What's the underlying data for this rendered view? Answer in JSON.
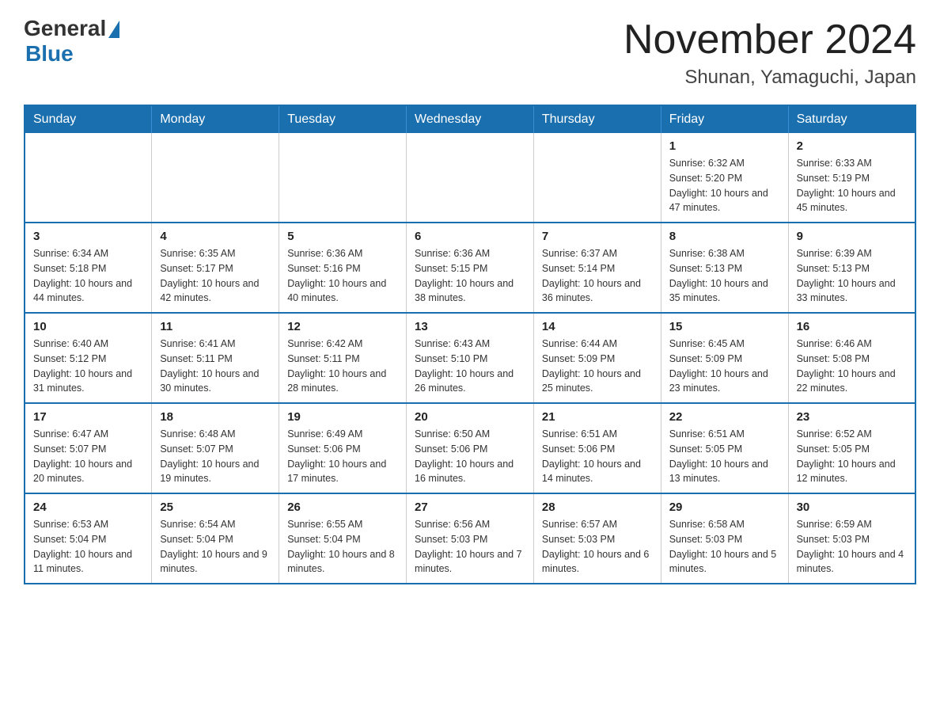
{
  "logo": {
    "general": "General",
    "blue": "Blue"
  },
  "title": {
    "month_year": "November 2024",
    "location": "Shunan, Yamaguchi, Japan"
  },
  "headers": [
    "Sunday",
    "Monday",
    "Tuesday",
    "Wednesday",
    "Thursday",
    "Friday",
    "Saturday"
  ],
  "weeks": [
    [
      {
        "day": "",
        "info": ""
      },
      {
        "day": "",
        "info": ""
      },
      {
        "day": "",
        "info": ""
      },
      {
        "day": "",
        "info": ""
      },
      {
        "day": "",
        "info": ""
      },
      {
        "day": "1",
        "info": "Sunrise: 6:32 AM\nSunset: 5:20 PM\nDaylight: 10 hours and 47 minutes."
      },
      {
        "day": "2",
        "info": "Sunrise: 6:33 AM\nSunset: 5:19 PM\nDaylight: 10 hours and 45 minutes."
      }
    ],
    [
      {
        "day": "3",
        "info": "Sunrise: 6:34 AM\nSunset: 5:18 PM\nDaylight: 10 hours and 44 minutes."
      },
      {
        "day": "4",
        "info": "Sunrise: 6:35 AM\nSunset: 5:17 PM\nDaylight: 10 hours and 42 minutes."
      },
      {
        "day": "5",
        "info": "Sunrise: 6:36 AM\nSunset: 5:16 PM\nDaylight: 10 hours and 40 minutes."
      },
      {
        "day": "6",
        "info": "Sunrise: 6:36 AM\nSunset: 5:15 PM\nDaylight: 10 hours and 38 minutes."
      },
      {
        "day": "7",
        "info": "Sunrise: 6:37 AM\nSunset: 5:14 PM\nDaylight: 10 hours and 36 minutes."
      },
      {
        "day": "8",
        "info": "Sunrise: 6:38 AM\nSunset: 5:13 PM\nDaylight: 10 hours and 35 minutes."
      },
      {
        "day": "9",
        "info": "Sunrise: 6:39 AM\nSunset: 5:13 PM\nDaylight: 10 hours and 33 minutes."
      }
    ],
    [
      {
        "day": "10",
        "info": "Sunrise: 6:40 AM\nSunset: 5:12 PM\nDaylight: 10 hours and 31 minutes."
      },
      {
        "day": "11",
        "info": "Sunrise: 6:41 AM\nSunset: 5:11 PM\nDaylight: 10 hours and 30 minutes."
      },
      {
        "day": "12",
        "info": "Sunrise: 6:42 AM\nSunset: 5:11 PM\nDaylight: 10 hours and 28 minutes."
      },
      {
        "day": "13",
        "info": "Sunrise: 6:43 AM\nSunset: 5:10 PM\nDaylight: 10 hours and 26 minutes."
      },
      {
        "day": "14",
        "info": "Sunrise: 6:44 AM\nSunset: 5:09 PM\nDaylight: 10 hours and 25 minutes."
      },
      {
        "day": "15",
        "info": "Sunrise: 6:45 AM\nSunset: 5:09 PM\nDaylight: 10 hours and 23 minutes."
      },
      {
        "day": "16",
        "info": "Sunrise: 6:46 AM\nSunset: 5:08 PM\nDaylight: 10 hours and 22 minutes."
      }
    ],
    [
      {
        "day": "17",
        "info": "Sunrise: 6:47 AM\nSunset: 5:07 PM\nDaylight: 10 hours and 20 minutes."
      },
      {
        "day": "18",
        "info": "Sunrise: 6:48 AM\nSunset: 5:07 PM\nDaylight: 10 hours and 19 minutes."
      },
      {
        "day": "19",
        "info": "Sunrise: 6:49 AM\nSunset: 5:06 PM\nDaylight: 10 hours and 17 minutes."
      },
      {
        "day": "20",
        "info": "Sunrise: 6:50 AM\nSunset: 5:06 PM\nDaylight: 10 hours and 16 minutes."
      },
      {
        "day": "21",
        "info": "Sunrise: 6:51 AM\nSunset: 5:06 PM\nDaylight: 10 hours and 14 minutes."
      },
      {
        "day": "22",
        "info": "Sunrise: 6:51 AM\nSunset: 5:05 PM\nDaylight: 10 hours and 13 minutes."
      },
      {
        "day": "23",
        "info": "Sunrise: 6:52 AM\nSunset: 5:05 PM\nDaylight: 10 hours and 12 minutes."
      }
    ],
    [
      {
        "day": "24",
        "info": "Sunrise: 6:53 AM\nSunset: 5:04 PM\nDaylight: 10 hours and 11 minutes."
      },
      {
        "day": "25",
        "info": "Sunrise: 6:54 AM\nSunset: 5:04 PM\nDaylight: 10 hours and 9 minutes."
      },
      {
        "day": "26",
        "info": "Sunrise: 6:55 AM\nSunset: 5:04 PM\nDaylight: 10 hours and 8 minutes."
      },
      {
        "day": "27",
        "info": "Sunrise: 6:56 AM\nSunset: 5:03 PM\nDaylight: 10 hours and 7 minutes."
      },
      {
        "day": "28",
        "info": "Sunrise: 6:57 AM\nSunset: 5:03 PM\nDaylight: 10 hours and 6 minutes."
      },
      {
        "day": "29",
        "info": "Sunrise: 6:58 AM\nSunset: 5:03 PM\nDaylight: 10 hours and 5 minutes."
      },
      {
        "day": "30",
        "info": "Sunrise: 6:59 AM\nSunset: 5:03 PM\nDaylight: 10 hours and 4 minutes."
      }
    ]
  ]
}
